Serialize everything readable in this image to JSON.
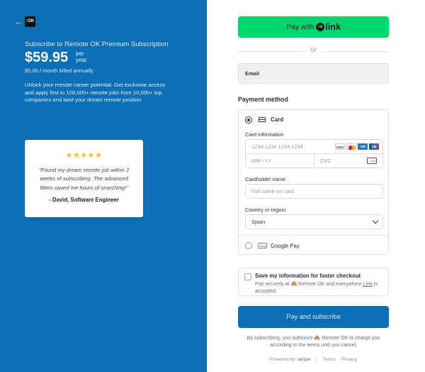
{
  "left": {
    "back_icon": "arrow-left-icon",
    "logo_text": "OK",
    "product_name": "Subscribe to Remote OK Premium Subscription",
    "price": "$59.95",
    "per_line1": "per",
    "per_line2": "year",
    "billing": "$5.00 / month billed annually",
    "description": "Unlock your remote career potential. Get exclusive access and apply first to 100,000+ remote jobs from 10,000+ top companies and land your dream remote position",
    "testimonial": {
      "stars": "★★★★★",
      "rating": 5,
      "quote": "\"Found my dream remote job within 2 weeks of subscribing. The advanced filters saved me hours of searching!\"",
      "author": "- David, Software Engineer"
    },
    "bg_color": "#0b6fb6"
  },
  "checkout": {
    "link_button": {
      "prefix": "Pay with",
      "brand": "link"
    },
    "or_text": "Or",
    "email_label": "Email",
    "payment_method_title": "Payment method",
    "card": {
      "label": "Card",
      "card_info_label": "Card information",
      "number_placeholder": "1234 1234 1234 1234",
      "brands": [
        "VISA",
        "MC",
        "AMEX",
        "CB"
      ],
      "expiry_placeholder": "MM / YY",
      "cvc_placeholder": "CVC",
      "cvc_icon_text": "123",
      "cardholder_label": "Cardholder name",
      "cardholder_placeholder": "Full name on card",
      "country_label": "Country or region",
      "country_value": "Spain"
    },
    "google_pay": {
      "label": "Google Pay",
      "icon_text": "GPay"
    },
    "save_info": {
      "title": "Save my information for faster checkout",
      "desc_prefix": "Pay securely at 🙈 Remote OK and everywhere ",
      "desc_link": "Link",
      "desc_suffix": " is accepted."
    },
    "pay_button": "Pay and subscribe",
    "terms": "By subscribing, you authorize 🙈 Remote OK to charge you according to the terms until you cancel.",
    "footer": {
      "powered_by": "Powered by",
      "stripe": "stripe",
      "terms_link": "Terms",
      "privacy_link": "Privacy"
    },
    "accent_color": "#00d66f"
  }
}
